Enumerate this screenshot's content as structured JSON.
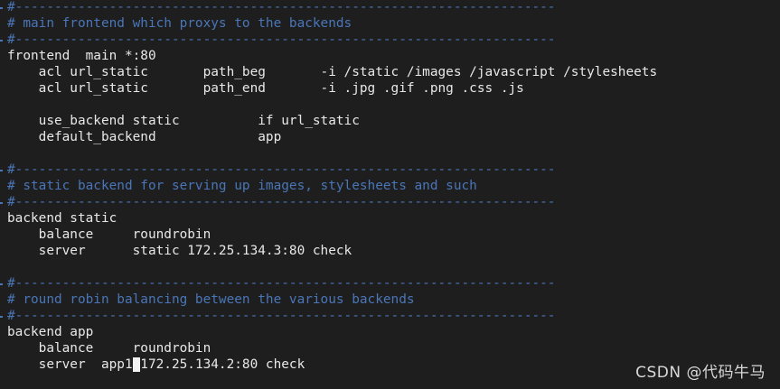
{
  "editor": {
    "lines": [
      {
        "kind": "comment",
        "text": "#---------------------------------------------------------------------"
      },
      {
        "kind": "comment",
        "text": "# main frontend which proxys to the backends"
      },
      {
        "kind": "comment",
        "text": "#---------------------------------------------------------------------"
      },
      {
        "kind": "code",
        "text": "frontend  main *:80"
      },
      {
        "kind": "code",
        "text": "    acl url_static       path_beg       -i /static /images /javascript /stylesheets"
      },
      {
        "kind": "code",
        "text": "    acl url_static       path_end       -i .jpg .gif .png .css .js"
      },
      {
        "kind": "blank",
        "text": ""
      },
      {
        "kind": "code",
        "text": "    use_backend static          if url_static"
      },
      {
        "kind": "code",
        "text": "    default_backend             app"
      },
      {
        "kind": "blank",
        "text": ""
      },
      {
        "kind": "comment",
        "text": "#---------------------------------------------------------------------"
      },
      {
        "kind": "comment",
        "text": "# static backend for serving up images, stylesheets and such"
      },
      {
        "kind": "comment",
        "text": "#---------------------------------------------------------------------"
      },
      {
        "kind": "code",
        "text": "backend static"
      },
      {
        "kind": "code",
        "text": "    balance     roundrobin"
      },
      {
        "kind": "code",
        "text": "    server      static 172.25.134.3:80 check"
      },
      {
        "kind": "blank",
        "text": ""
      },
      {
        "kind": "comment",
        "text": "#---------------------------------------------------------------------"
      },
      {
        "kind": "comment",
        "text": "# round robin balancing between the various backends"
      },
      {
        "kind": "comment",
        "text": "#---------------------------------------------------------------------"
      },
      {
        "kind": "code",
        "text": "backend app"
      },
      {
        "kind": "code",
        "text": "    balance     roundrobin"
      },
      {
        "kind": "cursor-line",
        "before": "    server  app1",
        "cursor": " ",
        "after": "172.25.134.2:80 check"
      }
    ]
  },
  "watermark": {
    "text": "CSDN @代码牛马"
  },
  "colors": {
    "background": "#1e1e1e",
    "text": "#e8e8e8",
    "comment": "#4a76b8",
    "cursor": "#f2f2f2"
  }
}
